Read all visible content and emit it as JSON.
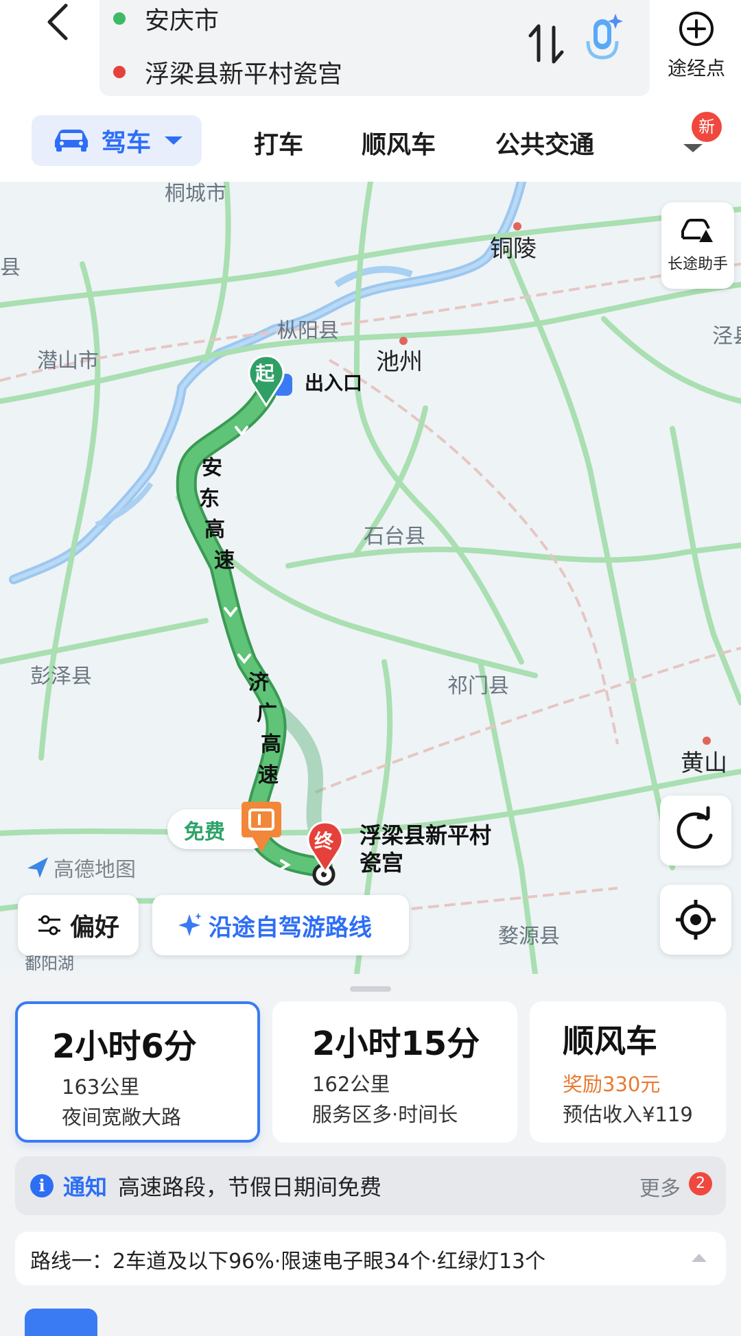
{
  "header": {
    "origin": "安庆市",
    "destination": "浮梁县新平村瓷宫",
    "waypoint_label": "途经点"
  },
  "tabs": {
    "active": "驾车",
    "items": [
      "打车",
      "顺风车",
      "公共交通"
    ],
    "badge": "新"
  },
  "map": {
    "labels": {
      "tongcheng": "桐城市",
      "tongling": "铜陵",
      "county_left": "县",
      "zongyang": "枞阳县",
      "chizhou": "池州",
      "qianshan": "潜山市",
      "jing": "泾县",
      "shitai": "石台县",
      "pengze": "彭泽县",
      "qimen": "祁门县",
      "huangshan": "黄山",
      "wuyuan": "婺源县",
      "poyang": "鄱阳湖",
      "exit": "出入口",
      "dest_line1": "浮梁县新平村",
      "dest_line2": "瓷宫",
      "road1": [
        "安",
        "东",
        "高",
        "速"
      ],
      "road2": [
        "济",
        "广",
        "高",
        "速"
      ],
      "start_marker": "起",
      "end_marker": "终"
    },
    "assistant_label": "长途助手",
    "free_tag": "免费",
    "logo": "高德地图",
    "preference_label": "偏好",
    "trip_label": "沿途自驾游路线"
  },
  "routes": [
    {
      "time": "2小时6分",
      "distance": "163公里",
      "note": "夜间宽敞大路"
    },
    {
      "time": "2小时15分",
      "distance": "162公里",
      "note": "服务区多·时间长"
    },
    {
      "time": "顺风车",
      "reward": "奖励330元",
      "note": "预估收入¥119"
    }
  ],
  "notice": {
    "title": "通知",
    "text": "高速路段，节假日期间免费",
    "more": "更多",
    "count": "2"
  },
  "route_detail": "路线一：2车道及以下96%·限速电子眼34个·红绿灯13个",
  "colors": {
    "accent": "#2d6ef5",
    "route": "#4cb86a",
    "origin_dot": "#3cba64",
    "destination_dot": "#e5403a",
    "reward": "#e87b32"
  }
}
